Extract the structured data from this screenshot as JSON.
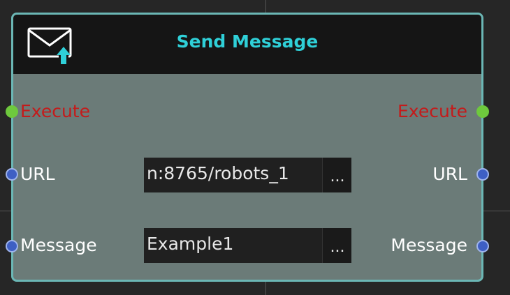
{
  "node": {
    "title": "Send Message",
    "icon": "envelope-upload-icon",
    "accent_color": "#2fd0d8",
    "border_color": "#6bb7b5"
  },
  "inputs": {
    "execute_label": "Execute",
    "url_label": "URL",
    "message_label": "Message"
  },
  "outputs": {
    "execute_label": "Execute",
    "url_label": "URL",
    "message_label": "Message"
  },
  "fields": {
    "url_value": "n:8765/robots_1",
    "message_value": "Example1",
    "browse_label": "..."
  },
  "colors": {
    "exec_port": "#6ec93d",
    "data_port": "#3e5fc4",
    "exec_text": "#c41b1b"
  }
}
